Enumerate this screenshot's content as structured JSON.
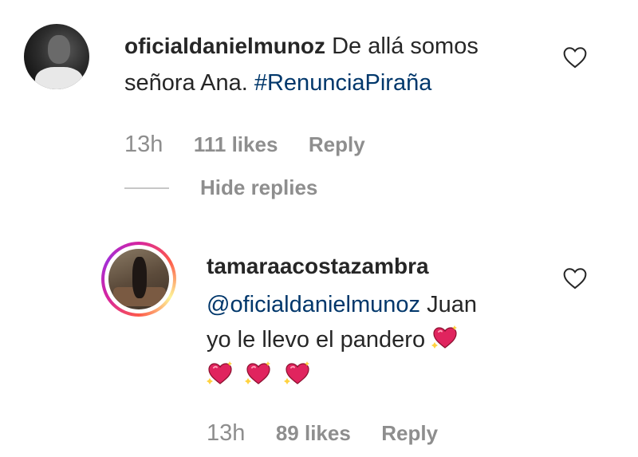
{
  "comment": {
    "username": "oficialdanielmunoz",
    "text_line1": "De allá somos",
    "text_line2_plain": "señora Ana.",
    "hashtag": "#RenunciaPiraña",
    "time": "13h",
    "likes": "111 likes",
    "reply_label": "Reply",
    "hide_replies_label": "Hide replies"
  },
  "reply": {
    "username": "tamaraacostazambra",
    "mention": "@oficialdanielmunoz",
    "text_line1_after_mention": "Juan",
    "text_line2": "yo le llevo el pandero",
    "emoji_name": "sparkling-heart-icon",
    "time": "13h",
    "likes": "89 likes",
    "reply_label": "Reply"
  },
  "colors": {
    "text": "#262626",
    "muted": "#8e8e8e",
    "link": "#00376b",
    "heart_emoji": "#e0245e"
  }
}
